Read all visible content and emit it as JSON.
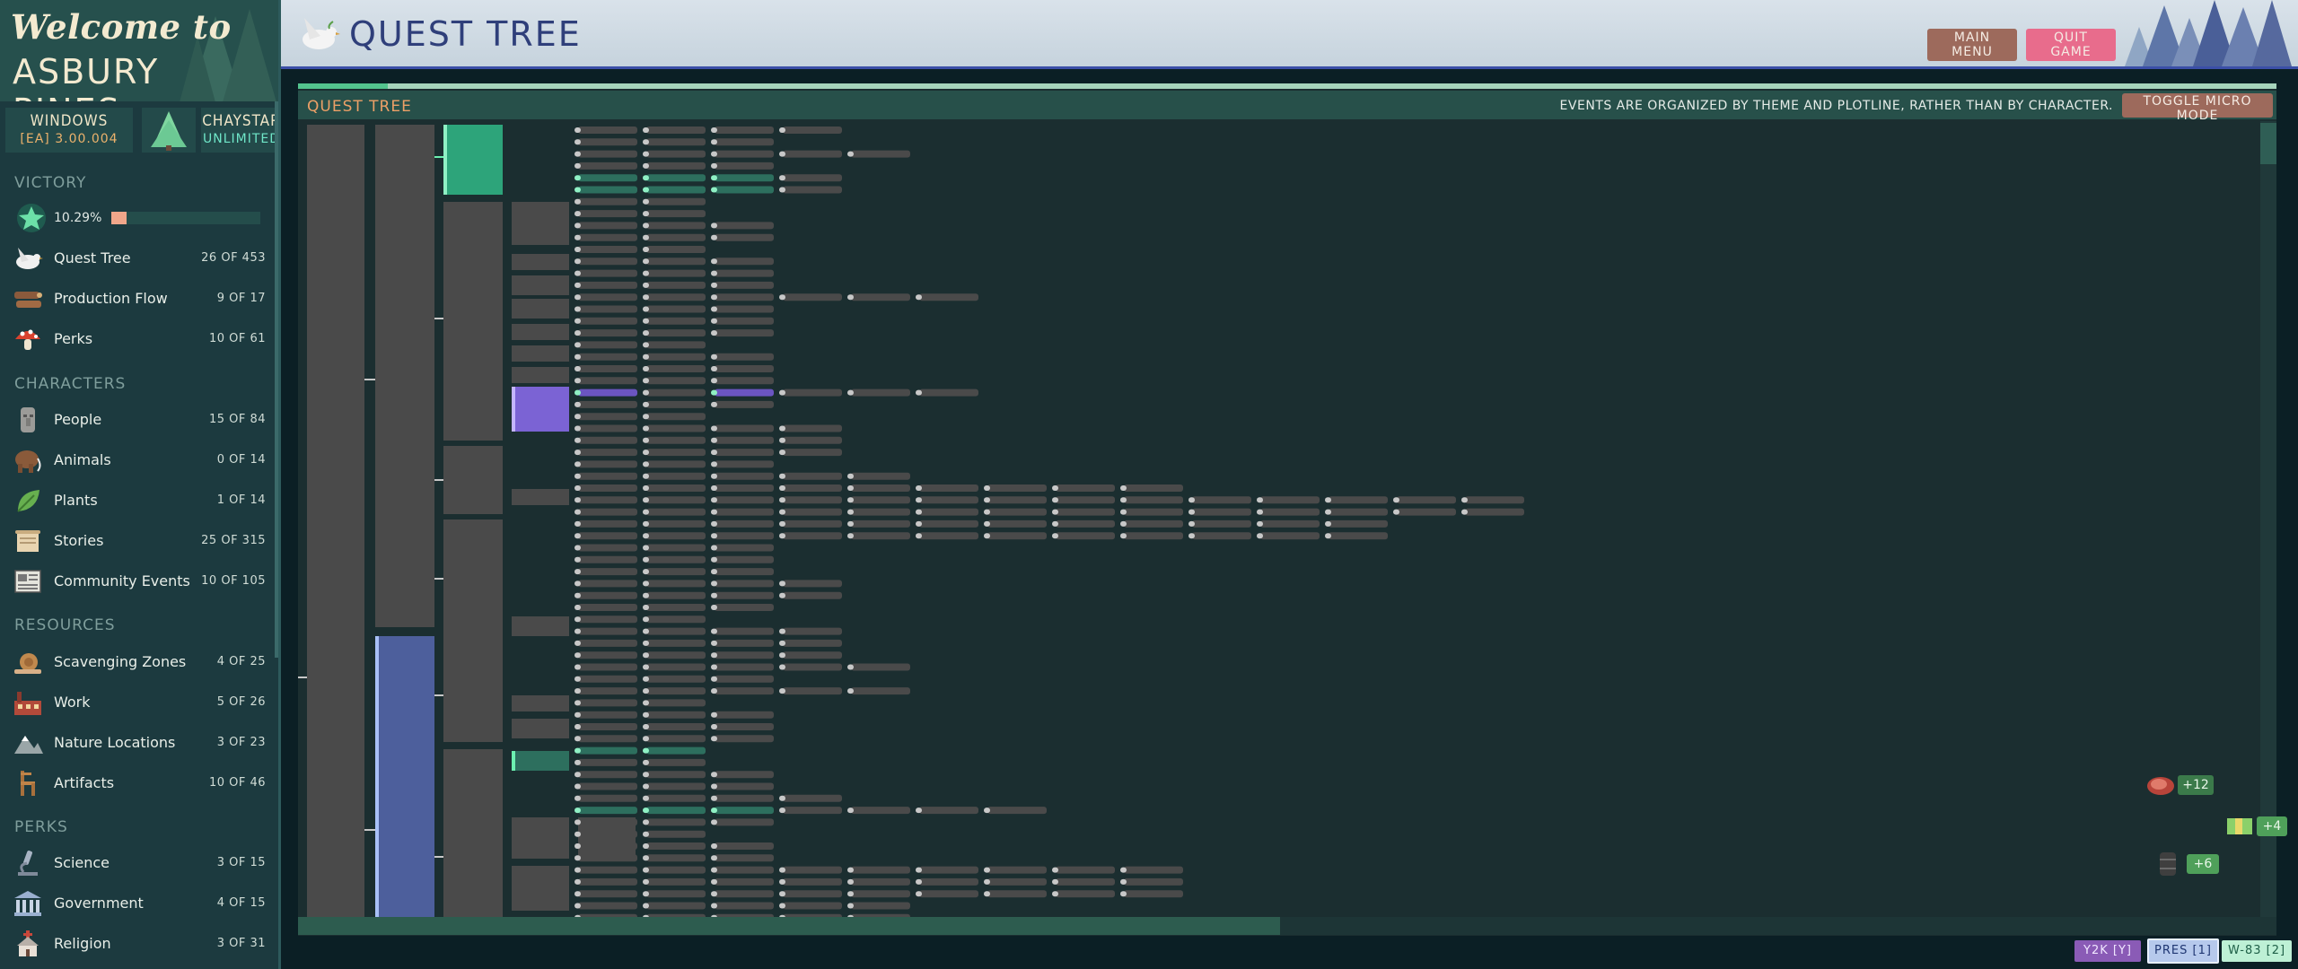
{
  "sidebar": {
    "welcome": "Welcome to",
    "brand": "ASBURY PINES",
    "platform_label": "WINDOWS",
    "version": "[EA] 3.00.004",
    "user_label": "CHAYSTAR",
    "user_status": "UNLIMITED",
    "victory": {
      "heading": "VICTORY",
      "percent_text": "10.29%",
      "percent": 0.1029
    },
    "items_victory": [
      {
        "label": "Quest Tree",
        "count": "26 OF 453"
      },
      {
        "label": "Production Flow",
        "count": "9 OF 17"
      },
      {
        "label": "Perks",
        "count": "10 OF 61"
      }
    ],
    "characters_heading": "CHARACTERS",
    "items_characters": [
      {
        "label": "People",
        "count": "15 OF 84"
      },
      {
        "label": "Animals",
        "count": "0 OF 14"
      },
      {
        "label": "Plants",
        "count": "1 OF 14"
      },
      {
        "label": "Stories",
        "count": "25 OF 315"
      },
      {
        "label": "Community Events",
        "count": "10 OF 105"
      }
    ],
    "resources_heading": "RESOURCES",
    "items_resources": [
      {
        "label": "Scavenging Zones",
        "count": "4 OF 25"
      },
      {
        "label": "Work",
        "count": "5 OF 26"
      },
      {
        "label": "Nature Locations",
        "count": "3 OF 23"
      },
      {
        "label": "Artifacts",
        "count": "10 OF 46"
      }
    ],
    "perks_heading": "PERKS",
    "items_perks": [
      {
        "label": "Science",
        "count": "3 OF 15"
      },
      {
        "label": "Government",
        "count": "4 OF 15"
      },
      {
        "label": "Religion",
        "count": "3 OF 31"
      }
    ]
  },
  "header": {
    "title": "QUEST TREE",
    "main_menu": "MAIN MENU",
    "quit_game": "QUIT GAME"
  },
  "panel": {
    "title": "QUEST TREE",
    "note": "EVENTS ARE ORGANIZED BY THEME AND PLOTLINE, RATHER THAN BY CHARACTER.",
    "toggle_micro": "TOGGLE MICRO MODE"
  },
  "rewards": [
    {
      "icon": "steak-icon",
      "label": "+12"
    },
    {
      "icon": "cash-icon",
      "label": "+4"
    },
    {
      "icon": "barrel-icon",
      "label": "+6"
    }
  ],
  "footer_tags": {
    "y2k": "Y2K [Y]",
    "pres": "PRES [1]",
    "w83": "W-83 [2]"
  },
  "colors": {
    "sidebar_bg": "#1c3a3f",
    "header_title": "#2f3f7a",
    "panel_title": "#eca067",
    "node_default": "#4a4a4a",
    "node_green": "#2da47a",
    "node_purple": "#7b63d4",
    "node_blue": "#4d5f9c",
    "quit_button": "#e86c8c",
    "menu_button": "#9d6a5c"
  }
}
